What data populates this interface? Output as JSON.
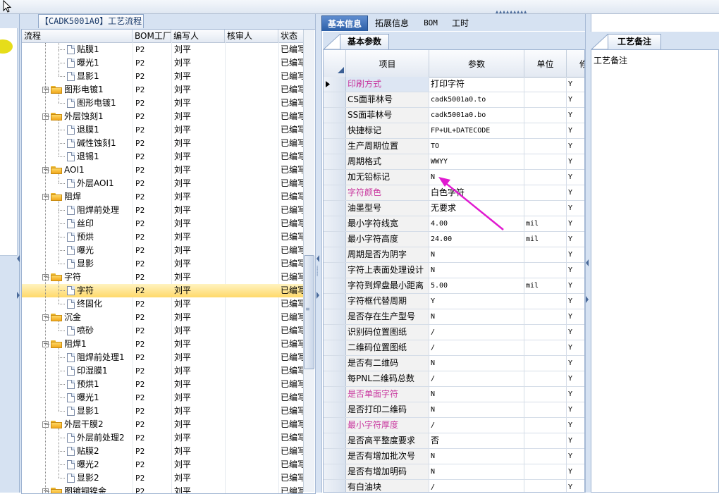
{
  "tree_panel": {
    "title": "【CADK5001A0】工艺流程",
    "columns": [
      "流程",
      "BOM工厂",
      "编写人",
      "核审人",
      "状态"
    ],
    "rows": [
      {
        "level": 1,
        "type": "doc",
        "name": "贴膜1",
        "factory": "P2",
        "writer": "刘平",
        "status": "已编写"
      },
      {
        "level": 1,
        "type": "doc",
        "name": "曝光1",
        "factory": "P2",
        "writer": "刘平",
        "status": "已编写"
      },
      {
        "level": 1,
        "type": "doc",
        "name": "显影1",
        "factory": "P2",
        "writer": "刘平",
        "status": "已编写"
      },
      {
        "level": 0,
        "type": "folder",
        "name": "图形电镀1",
        "factory": "P2",
        "writer": "刘平",
        "status": "已编写"
      },
      {
        "level": 1,
        "type": "doc",
        "name": "图形电镀1",
        "factory": "P2",
        "writer": "刘平",
        "status": "已编写"
      },
      {
        "level": 0,
        "type": "folder",
        "name": "外层蚀刻1",
        "factory": "P2",
        "writer": "刘平",
        "status": "已编写"
      },
      {
        "level": 1,
        "type": "doc",
        "name": "退膜1",
        "factory": "P2",
        "writer": "刘平",
        "status": "已编写"
      },
      {
        "level": 1,
        "type": "doc",
        "name": "碱性蚀刻1",
        "factory": "P2",
        "writer": "刘平",
        "status": "已编写"
      },
      {
        "level": 1,
        "type": "doc",
        "name": "退锡1",
        "factory": "P2",
        "writer": "刘平",
        "status": "已编写"
      },
      {
        "level": 0,
        "type": "folder",
        "name": "AOI1",
        "factory": "P2",
        "writer": "刘平",
        "status": "已编写"
      },
      {
        "level": 1,
        "type": "doc",
        "name": "外层AOI1",
        "factory": "P2",
        "writer": "刘平",
        "status": "已编写"
      },
      {
        "level": 0,
        "type": "folder",
        "name": "阻焊",
        "factory": "P2",
        "writer": "刘平",
        "status": "已编写"
      },
      {
        "level": 1,
        "type": "doc",
        "name": "阻焊前处理",
        "factory": "P2",
        "writer": "刘平",
        "status": "已编写"
      },
      {
        "level": 1,
        "type": "doc",
        "name": "丝印",
        "factory": "P2",
        "writer": "刘平",
        "status": "已编写"
      },
      {
        "level": 1,
        "type": "doc",
        "name": "预烘",
        "factory": "P2",
        "writer": "刘平",
        "status": "已编写"
      },
      {
        "level": 1,
        "type": "doc",
        "name": "曝光",
        "factory": "P2",
        "writer": "刘平",
        "status": "已编写"
      },
      {
        "level": 1,
        "type": "doc",
        "name": "显影",
        "factory": "P2",
        "writer": "刘平",
        "status": "已编写"
      },
      {
        "level": 0,
        "type": "folder",
        "name": "字符",
        "factory": "P2",
        "writer": "刘平",
        "status": "已编写"
      },
      {
        "level": 1,
        "type": "doc",
        "name": "字符",
        "factory": "P2",
        "writer": "刘平",
        "status": "已编写",
        "selected": true
      },
      {
        "level": 1,
        "type": "doc",
        "name": "终固化",
        "factory": "P2",
        "writer": "刘平",
        "status": "已编写"
      },
      {
        "level": 0,
        "type": "folder",
        "name": "沉金",
        "factory": "P2",
        "writer": "刘平",
        "status": "已编写"
      },
      {
        "level": 1,
        "type": "doc",
        "name": "喷砂",
        "factory": "P2",
        "writer": "刘平",
        "status": "已编写"
      },
      {
        "level": 0,
        "type": "folder",
        "name": "阻焊1",
        "factory": "P2",
        "writer": "刘平",
        "status": "已编写"
      },
      {
        "level": 1,
        "type": "doc",
        "name": "阻焊前处理1",
        "factory": "P2",
        "writer": "刘平",
        "status": "已编写"
      },
      {
        "level": 1,
        "type": "doc",
        "name": "印湿膜1",
        "factory": "P2",
        "writer": "刘平",
        "status": "已编写"
      },
      {
        "level": 1,
        "type": "doc",
        "name": "预烘1",
        "factory": "P2",
        "writer": "刘平",
        "status": "已编写"
      },
      {
        "level": 1,
        "type": "doc",
        "name": "曝光1",
        "factory": "P2",
        "writer": "刘平",
        "status": "已编写"
      },
      {
        "level": 1,
        "type": "doc",
        "name": "显影1",
        "factory": "P2",
        "writer": "刘平",
        "status": "已编写"
      },
      {
        "level": 0,
        "type": "folder",
        "name": "外层干膜2",
        "factory": "P2",
        "writer": "刘平",
        "status": "已编写"
      },
      {
        "level": 1,
        "type": "doc",
        "name": "外层前处理2",
        "factory": "P2",
        "writer": "刘平",
        "status": "已编写"
      },
      {
        "level": 1,
        "type": "doc",
        "name": "贴膜2",
        "factory": "P2",
        "writer": "刘平",
        "status": "已编写"
      },
      {
        "level": 1,
        "type": "doc",
        "name": "曝光2",
        "factory": "P2",
        "writer": "刘平",
        "status": "已编写"
      },
      {
        "level": 1,
        "type": "doc",
        "name": "显影2",
        "factory": "P2",
        "writer": "刘平",
        "status": "已编写"
      },
      {
        "level": 0,
        "type": "folder",
        "name": "图镀铜镍金",
        "factory": "P2",
        "writer": "刘平",
        "status": "已编写"
      }
    ]
  },
  "tabs": [
    "基本信息",
    "拓展信息",
    "BOM",
    "工时"
  ],
  "subtab": "基本参数",
  "grid": {
    "columns": [
      "项目",
      "参数",
      "单位",
      "修"
    ],
    "rows": [
      {
        "item": "印刷方式",
        "value": "打印字符",
        "unit": "",
        "flag": "Y",
        "pink": true,
        "current": true
      },
      {
        "item": "CS面菲林号",
        "value": "cadk5001a0.to",
        "unit": "",
        "flag": "Y",
        "mono": true
      },
      {
        "item": "SS面菲林号",
        "value": "cadk5001a0.bo",
        "unit": "",
        "flag": "Y",
        "mono": true
      },
      {
        "item": "快捷标记",
        "value": "FP+UL+DATECODE",
        "unit": "",
        "flag": "Y",
        "mono": true
      },
      {
        "item": "生产周期位置",
        "value": "TO",
        "unit": "",
        "flag": "Y",
        "mono": true
      },
      {
        "item": "周期格式",
        "value": "WWYY",
        "unit": "",
        "flag": "Y",
        "mono": true
      },
      {
        "item": "加无铅标记",
        "value": "N",
        "unit": "",
        "flag": "Y",
        "mono": true
      },
      {
        "item": "字符颜色",
        "value": "白色字符",
        "unit": "",
        "flag": "Y",
        "pink": true
      },
      {
        "item": "油墨型号",
        "value": "无要求",
        "unit": "",
        "flag": "Y"
      },
      {
        "item": "最小字符线宽",
        "value": "4.00",
        "unit": "mil",
        "flag": "Y",
        "mono": true
      },
      {
        "item": "最小字符高度",
        "value": "24.00",
        "unit": "mil",
        "flag": "Y",
        "mono": true
      },
      {
        "item": "周期是否为阴字",
        "value": "N",
        "unit": "",
        "flag": "Y",
        "mono": true
      },
      {
        "item": "字符上表面处理设计",
        "value": "N",
        "unit": "",
        "flag": "Y",
        "mono": true
      },
      {
        "item": "字符到焊盘最小距离",
        "value": "5.00",
        "unit": "mil",
        "flag": "Y",
        "mono": true
      },
      {
        "item": "字符框代替周期",
        "value": "Y",
        "unit": "",
        "flag": "Y",
        "mono": true
      },
      {
        "item": "是否存在生产型号",
        "value": "N",
        "unit": "",
        "flag": "Y",
        "mono": true
      },
      {
        "item": "识别码位置图纸",
        "value": "/",
        "unit": "",
        "flag": "Y",
        "mono": true
      },
      {
        "item": "二维码位置图纸",
        "value": "/",
        "unit": "",
        "flag": "Y",
        "mono": true
      },
      {
        "item": "是否有二维码",
        "value": "N",
        "unit": "",
        "flag": "Y",
        "mono": true
      },
      {
        "item": "每PNL二维码总数",
        "value": "/",
        "unit": "",
        "flag": "Y",
        "mono": true
      },
      {
        "item": "是否单面字符",
        "value": "N",
        "unit": "",
        "flag": "Y",
        "mono": true,
        "pink": true
      },
      {
        "item": "是否打印二维码",
        "value": "N",
        "unit": "",
        "flag": "Y",
        "mono": true
      },
      {
        "item": "最小字符厚度",
        "value": "/",
        "unit": "",
        "flag": "Y",
        "mono": true,
        "pink": true
      },
      {
        "item": "是否高平整度要求",
        "value": "否",
        "unit": "",
        "flag": "Y"
      },
      {
        "item": "是否有增加批次号",
        "value": "N",
        "unit": "",
        "flag": "Y",
        "mono": true
      },
      {
        "item": "是否有增加明码",
        "value": "N",
        "unit": "",
        "flag": "Y",
        "mono": true
      },
      {
        "item": "有白油块",
        "value": "/",
        "unit": "",
        "flag": "Y",
        "mono": true
      }
    ]
  },
  "notes_panel": {
    "tab": "工艺备注",
    "label": "工艺备注"
  },
  "colors": {
    "accent": "#2b5ea6",
    "highlight": "#ffd96a",
    "pink_text": "#c8369e",
    "arrow": "#e01ad0",
    "panel_bg": "#d6e2f2"
  }
}
